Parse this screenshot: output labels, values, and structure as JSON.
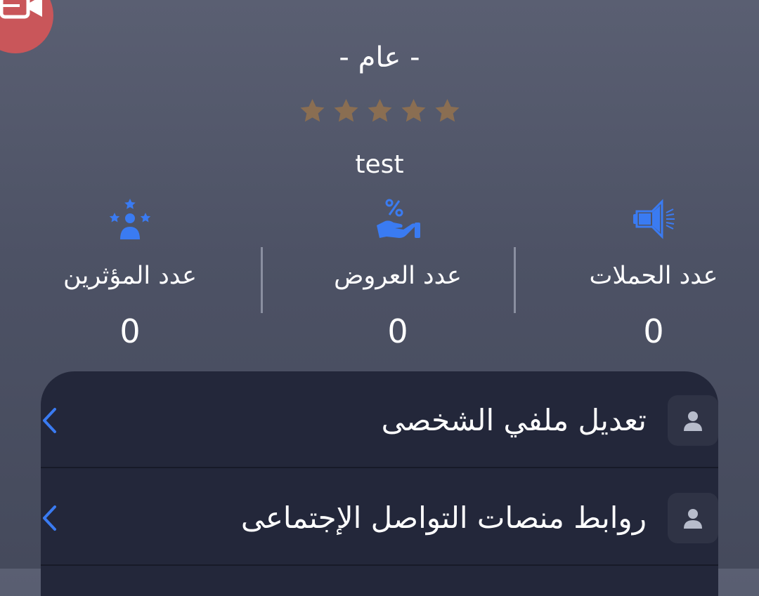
{
  "profile": {
    "category": "- عام -",
    "rating": 5,
    "username": "test"
  },
  "stats": [
    {
      "label": "عدد الحملات",
      "value": "0",
      "icon": "megaphone-icon"
    },
    {
      "label": "عدد العروض",
      "value": "0",
      "icon": "offer-hand-percent-icon"
    },
    {
      "label": "عدد المؤثرين",
      "value": "0",
      "icon": "influencer-stars-icon"
    }
  ],
  "menu": [
    {
      "label": "تعديل ملفي الشخصى",
      "icon": "user-icon"
    },
    {
      "label": "روابط منصات التواصل الإجتماعى",
      "icon": "user-icon"
    }
  ],
  "colors": {
    "accent": "#3a7bf2",
    "star": "#8a6e52",
    "panel": "#23273a",
    "record_badge": "#c9565a"
  }
}
